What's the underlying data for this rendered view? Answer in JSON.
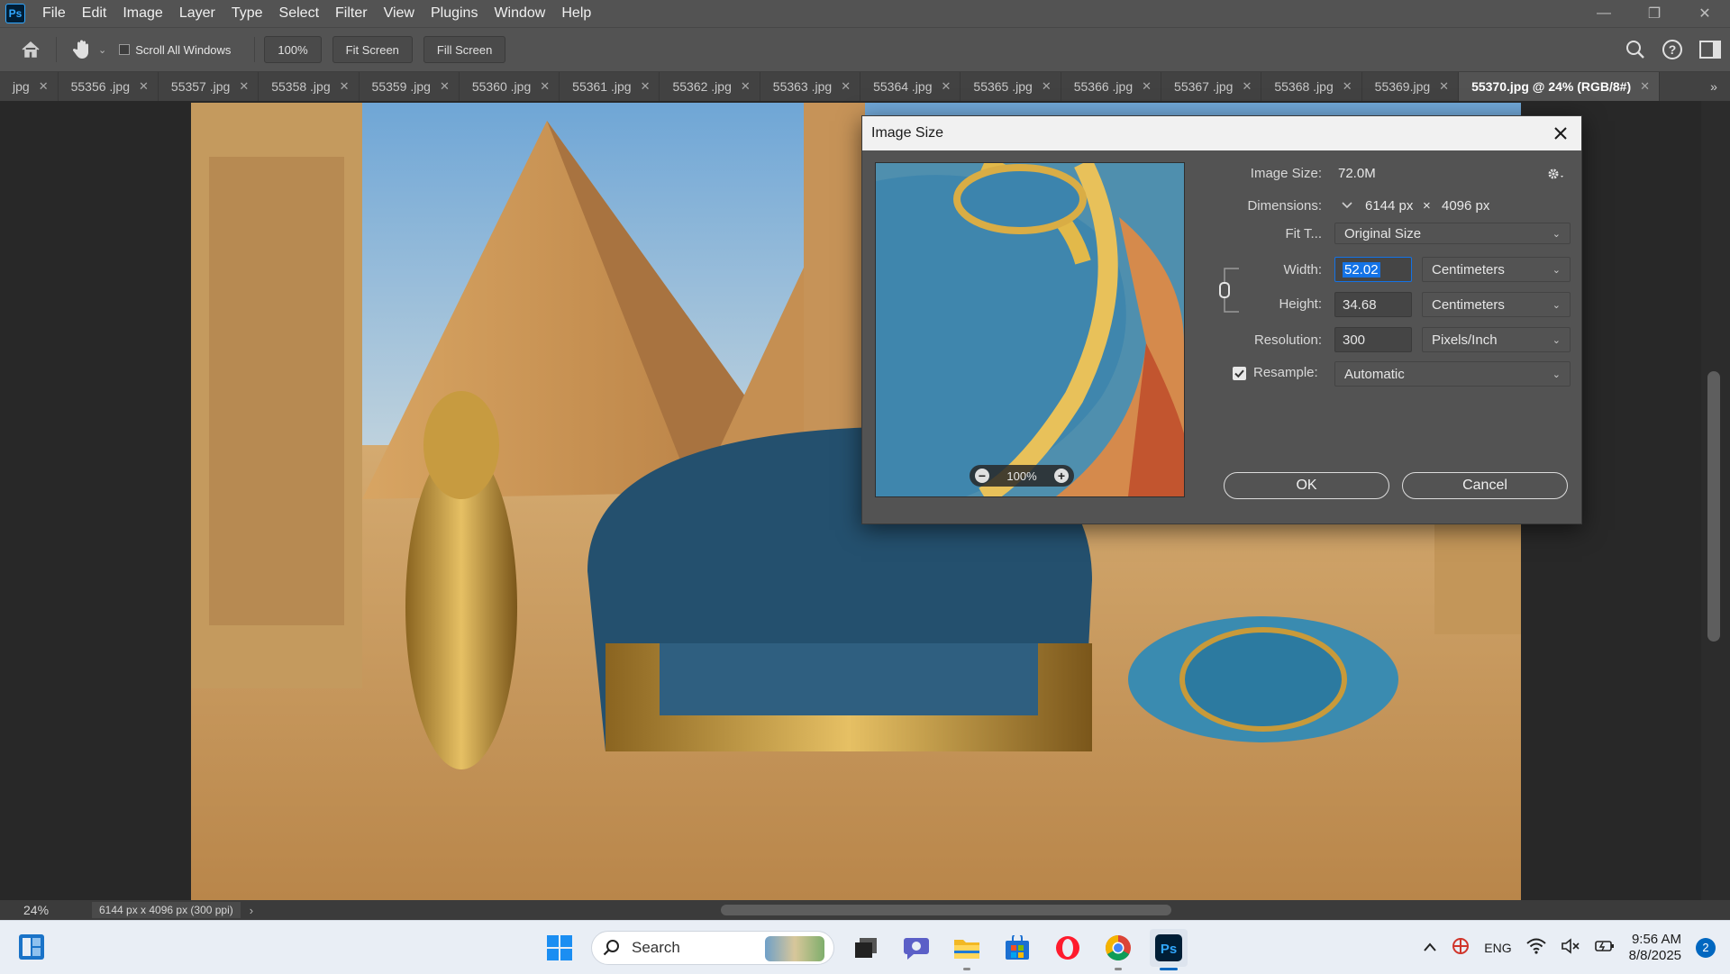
{
  "app": {
    "logo_text": "Ps"
  },
  "menu": [
    "File",
    "Edit",
    "Image",
    "Layer",
    "Type",
    "Select",
    "Filter",
    "View",
    "Plugins",
    "Window",
    "Help"
  ],
  "options": {
    "scroll_all_label": "Scroll All Windows",
    "zoom_btn": "100%",
    "fit_screen": "Fit Screen",
    "fill_screen": "Fill Screen"
  },
  "tabs": [
    {
      "label": "jpg",
      "active": false
    },
    {
      "label": "55356 .jpg",
      "active": false
    },
    {
      "label": "55357 .jpg",
      "active": false
    },
    {
      "label": "55358 .jpg",
      "active": false
    },
    {
      "label": "55359 .jpg",
      "active": false
    },
    {
      "label": "55360 .jpg",
      "active": false
    },
    {
      "label": "55361 .jpg",
      "active": false
    },
    {
      "label": "55362 .jpg",
      "active": false
    },
    {
      "label": "55363 .jpg",
      "active": false
    },
    {
      "label": "55364 .jpg",
      "active": false
    },
    {
      "label": "55365 .jpg",
      "active": false
    },
    {
      "label": "55366 .jpg",
      "active": false
    },
    {
      "label": "55367 .jpg",
      "active": false
    },
    {
      "label": "55368 .jpg",
      "active": false
    },
    {
      "label": "55369.jpg",
      "active": false
    },
    {
      "label": "55370.jpg @ 24% (RGB/8#)",
      "active": true
    }
  ],
  "status": {
    "zoom": "24%",
    "doc_info": "6144 px x 4096 px (300 ppi)"
  },
  "dialog": {
    "title": "Image Size",
    "image_size_label": "Image Size:",
    "image_size_value": "72.0M",
    "dimensions_label": "Dimensions:",
    "dim_w": "6144 px",
    "dim_x": "×",
    "dim_h": "4096 px",
    "fit_label": "Fit T...",
    "fit_value": "Original Size",
    "width_label": "Width:",
    "width_value": "52.02",
    "width_unit": "Centimeters",
    "height_label": "Height:",
    "height_value": "34.68",
    "height_unit": "Centimeters",
    "resolution_label": "Resolution:",
    "resolution_value": "300",
    "resolution_unit": "Pixels/Inch",
    "resample_label": "Resample:",
    "resample_value": "Automatic",
    "preview_zoom": "100%",
    "ok": "OK",
    "cancel": "Cancel"
  },
  "taskbar": {
    "search_placeholder": "Search",
    "lang": "ENG",
    "time": "9:56 AM",
    "date": "8/8/2025",
    "notif_count": "2"
  }
}
